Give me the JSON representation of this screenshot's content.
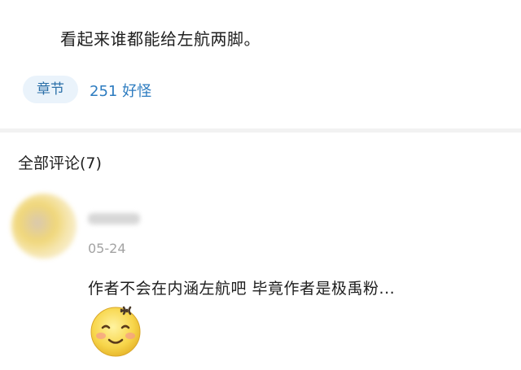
{
  "post": {
    "text": "看起来谁都能给左航两脚。",
    "chapter_tag": "章节",
    "chapter_link": "251 好怪"
  },
  "comments": {
    "heading": "全部评论(7)",
    "items": [
      {
        "date": "05-24",
        "text": "作者不会在内涵左航吧 毕竟作者是极禹粉...",
        "emoji": "angry-smile-emoji"
      }
    ]
  },
  "colors": {
    "accent": "#2d7cc0",
    "tag_bg": "#eaf3fb",
    "date": "#a3a3a3"
  }
}
